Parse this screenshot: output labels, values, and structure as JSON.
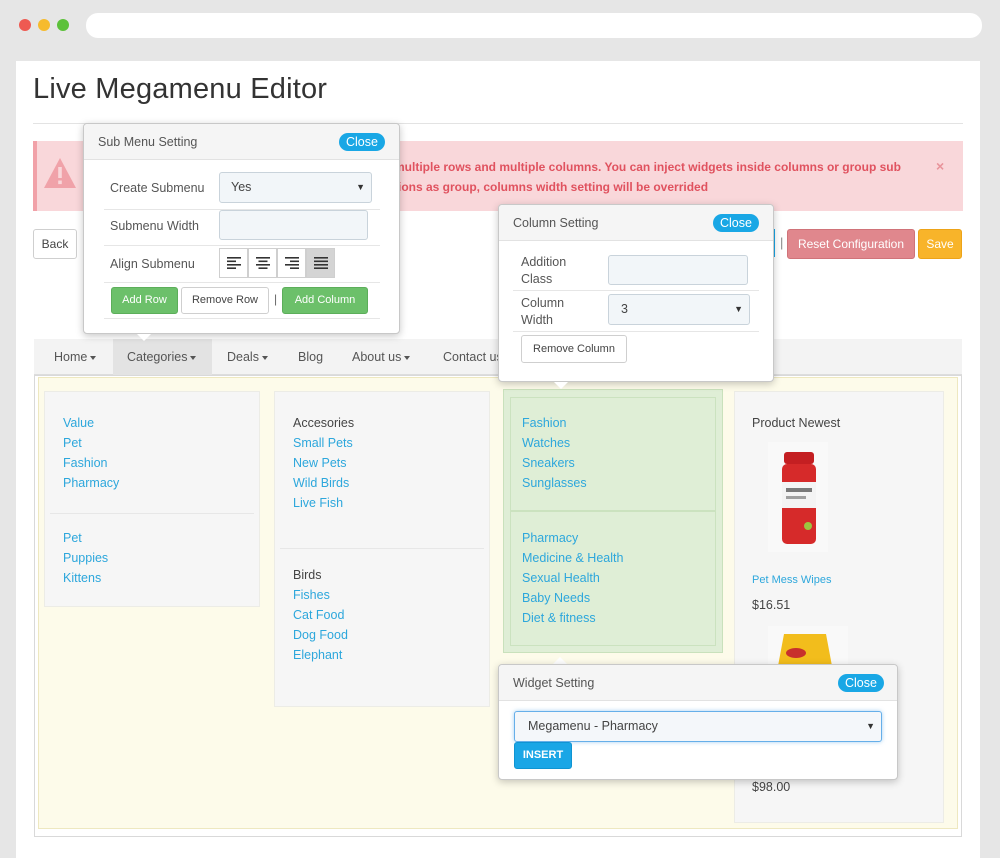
{
  "page": {
    "title": "Live Megamenu Editor",
    "alert_line1": "multiple rows and multiple columns. You can inject widgets inside columns or group sub",
    "alert_line2": "tions as group, columns width setting will be overrided",
    "alert_close": "×"
  },
  "toolbar": {
    "back": "Back",
    "reset": "Reset Configuration",
    "save": "Save"
  },
  "nav": {
    "items": [
      "Home",
      "Categories",
      "Deals",
      "Blog",
      "About us",
      "Contact us"
    ]
  },
  "menu": {
    "col1": {
      "group1": [
        "Value",
        "Pet",
        "Fashion",
        "Pharmacy"
      ],
      "group2": [
        "Pet",
        "Puppies",
        "Kittens"
      ]
    },
    "col2": {
      "group1_title": "Accesories",
      "group1": [
        "Small Pets",
        "New Pets",
        "Wild Birds",
        "Live Fish"
      ],
      "group2_title": "Birds",
      "group2": [
        "Fishes",
        "Cat Food",
        "Dog Food",
        "Elephant"
      ]
    },
    "col3": {
      "group1": [
        "Fashion",
        "Watches",
        "Sneakers",
        "Sunglasses"
      ],
      "group2": [
        "Pharmacy",
        "Medicine & Health",
        "Sexual Health",
        "Baby Needs",
        "Diet & fitness"
      ]
    },
    "col4": {
      "title": "Product Newest",
      "product1_name": "Pet Mess Wipes",
      "product1_price": "$16.51",
      "product2_price": "$98.00"
    }
  },
  "submenu_panel": {
    "title": "Sub Menu Setting",
    "close": "Close",
    "create_label": "Create Submenu",
    "create_value": "Yes",
    "width_label": "Submenu Width",
    "width_value": "",
    "align_label": "Align Submenu",
    "add_row": "Add Row",
    "remove_row": "Remove Row",
    "separator": "|",
    "add_column": "Add Column"
  },
  "column_panel": {
    "title": "Column Setting",
    "close": "Close",
    "class_label_1": "Addition",
    "class_label_2": "Class",
    "class_value": "",
    "width_label_1": "Column",
    "width_label_2": "Width",
    "width_value": "3",
    "remove": "Remove Column"
  },
  "widget_panel": {
    "title": "Widget Setting",
    "close": "Close",
    "selected": "Megamenu - Pharmacy",
    "insert": "INSERT"
  },
  "colors": {
    "accent": "#19a7e5",
    "green": "#6cc06a",
    "danger": "#e0878d",
    "warning": "#f8b42a",
    "alert_bg": "#f9d7da",
    "menu_bg": "#fdfbea",
    "active_col": "#dfeed6"
  }
}
